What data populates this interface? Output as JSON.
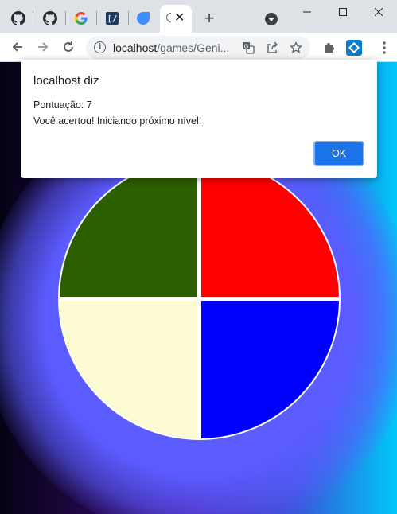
{
  "browser": {
    "tabs": [
      {
        "icon": "github-icon"
      },
      {
        "icon": "github-icon"
      },
      {
        "icon": "google-icon"
      },
      {
        "icon": "bracket-icon"
      },
      {
        "icon": "drop-icon"
      }
    ],
    "active_tab": {
      "close_glyph": "✕"
    },
    "new_tab_glyph": "+",
    "window": {
      "minimize": "—",
      "maximize": "☐",
      "close": "✕"
    },
    "address": {
      "host": "localhost",
      "path": "/games/Geni..."
    }
  },
  "dialog": {
    "title": "localhost diz",
    "message_line1": "Pontuação: 7",
    "message_line2": "Você acertou! Iniciando próximo nível!",
    "ok_label": "OK"
  },
  "game": {
    "colors": {
      "green": "#2c5f00",
      "red": "#ff0000",
      "yellow": "#fcfad0",
      "blue": "#0000ff"
    }
  }
}
